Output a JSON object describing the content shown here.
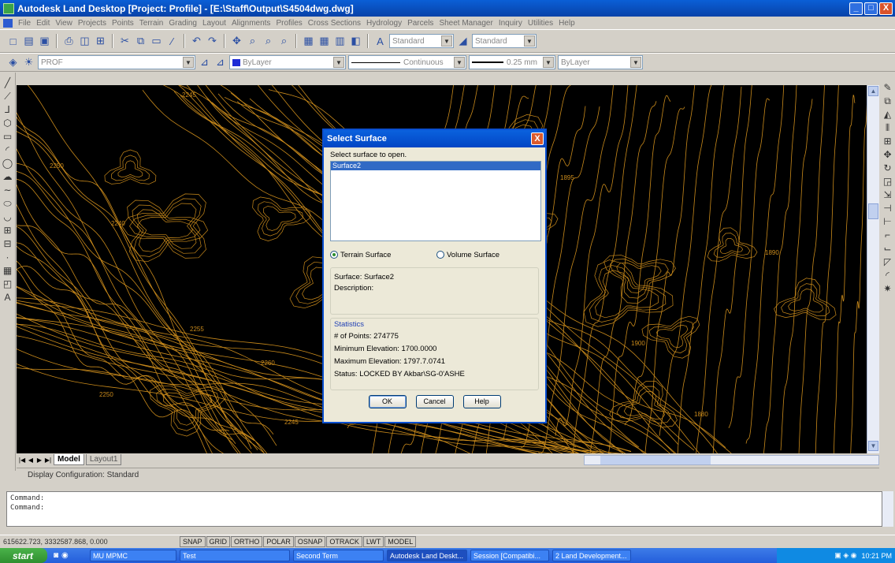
{
  "window": {
    "title": "Autodesk Land Desktop [Project: Profile] - [E:\\Staff\\Output\\S4504dwg.dwg]",
    "min_label": "_",
    "max_label": "□",
    "close_label": "X"
  },
  "menubar": [
    "File",
    "Edit",
    "View",
    "Projects",
    "Points",
    "Terrain",
    "Grading",
    "Layout",
    "Alignments",
    "Profiles",
    "Cross Sections",
    "Hydrology",
    "Parcels",
    "Sheet Manager",
    "Inquiry",
    "Utilities",
    "Help"
  ],
  "toolbar": {
    "textstyle": "Standard",
    "dimstyle": "Standard",
    "layer": "PROF",
    "color": "ByLayer",
    "linetype": "Continuous",
    "lineweight": "0.25 mm",
    "plotstyle": "ByLayer"
  },
  "layout_tabs": {
    "model": "Model",
    "layout1": "Layout1"
  },
  "display_config": "Display Configuration:  Standard",
  "command_lines": [
    "Command:",
    "Command:"
  ],
  "statusbar": {
    "coords": "615622.723, 3332587.868, 0.000",
    "toggles": [
      "SNAP",
      "GRID",
      "ORTHO",
      "POLAR",
      "OSNAP",
      "OTRACK",
      "LWT",
      "MODEL"
    ]
  },
  "taskbar": {
    "start": "start",
    "tasks": [
      "MU MPMC",
      "Test",
      "Second Term",
      "Autodesk Land Deskt...",
      "Session [Compatibi...",
      "2 Land Development..."
    ],
    "clock": "10:21 PM"
  },
  "contour_labels": [
    "2245",
    "2250",
    "2240",
    "2255",
    "2260",
    "2250",
    "2245",
    "1895",
    "1890",
    "1900",
    "1880"
  ],
  "dialog": {
    "title": "Select Surface",
    "close_label": "X",
    "prompt": "Select surface to open.",
    "surfaces": [
      "Surface2"
    ],
    "selected_index": 0,
    "radio_terrain": "Terrain Surface",
    "radio_volume": "Volume Surface",
    "surface_line": "Surface: Surface2",
    "description_line": "Description:",
    "stats_label": "Statistics",
    "points_line": "# of Points: 274775",
    "min_elev_line": "Minimum Elevation: 1700.0000",
    "max_elev_line": "Maximum Elevation: 1797.7.0741",
    "status_line": "Status: LOCKED BY Akbar\\SG-0'ASHE",
    "ok": "OK",
    "cancel": "Cancel",
    "help": "Help"
  },
  "colors": {
    "canvas": "#000000",
    "contour": "#c98a1b",
    "title_blue": "#0a55d4",
    "selection": "#316ac5"
  }
}
